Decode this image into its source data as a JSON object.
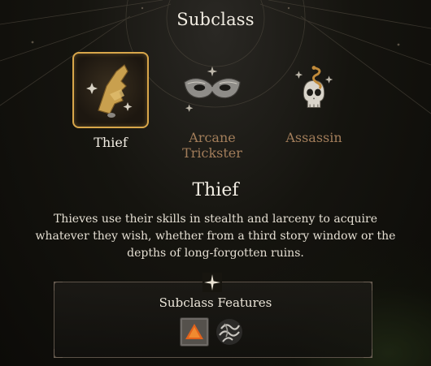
{
  "header": {
    "title": "Subclass"
  },
  "subclasses": [
    {
      "label": "Thief",
      "icon": "thief-hand-icon",
      "selected": true
    },
    {
      "label": "Arcane Trickster",
      "icon": "masquerade-mask-icon",
      "selected": false
    },
    {
      "label": "Assassin",
      "icon": "skull-serpent-icon",
      "selected": false
    }
  ],
  "detail": {
    "title": "Thief",
    "description": "Thieves use their skills in stealth and larceny to acquire whatever they wish, whether from a third story window or the depths of long-forgotten ruins."
  },
  "features": {
    "title": "Subclass Features",
    "icons": [
      "fast-hands-icon",
      "second-story-work-icon"
    ]
  },
  "colors": {
    "accent_gold": "#d8a64a",
    "unselected_label": "#a27d5a"
  }
}
